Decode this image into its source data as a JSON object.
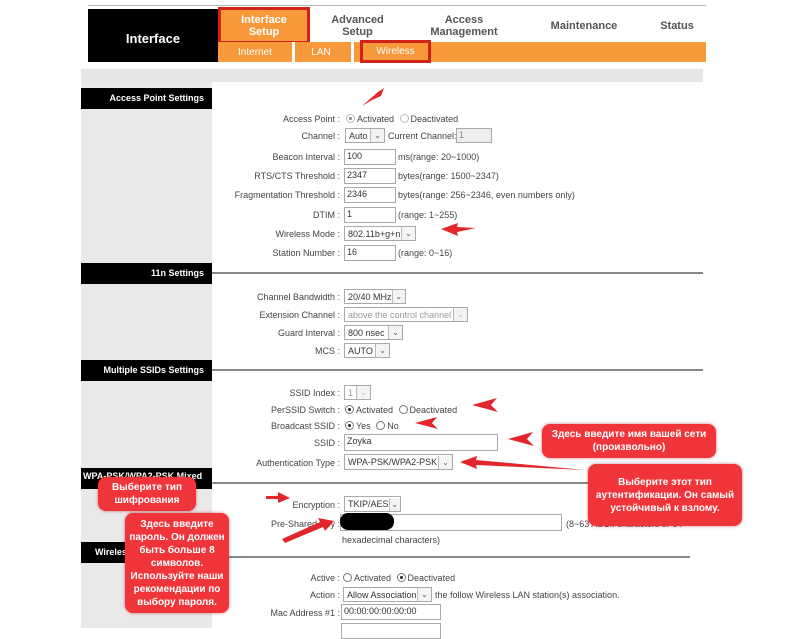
{
  "header": {
    "logo_text": "Interface",
    "nav": [
      {
        "label_line1": "Interface",
        "label_line2": "Setup",
        "active": true
      },
      {
        "label_line1": "Advanced",
        "label_line2": "Setup",
        "active": false
      },
      {
        "label_line1": "Access",
        "label_line2": "Management",
        "active": false
      },
      {
        "label_line1": "Maintenance",
        "label_line2": "",
        "active": false
      },
      {
        "label_line1": "Status",
        "label_line2": "",
        "active": false
      }
    ],
    "subnav": [
      {
        "label": "Internet"
      },
      {
        "label": "LAN"
      },
      {
        "label": "Wireless",
        "active": true
      }
    ]
  },
  "sections": {
    "access_point": {
      "title": "Access Point Settings",
      "access_point": {
        "label": "Access Point :",
        "options": [
          "Activated",
          "Deactivated"
        ],
        "selected": "Activated"
      },
      "channel": {
        "label": "Channel :",
        "value": "Auto",
        "current_label": "Current Channel:",
        "current_value": "1"
      },
      "beacon": {
        "label": "Beacon Interval :",
        "value": "100",
        "hint": "ms(range: 20~1000)"
      },
      "rts": {
        "label": "RTS/CTS Threshold :",
        "value": "2347",
        "hint": "bytes(range: 1500~2347)"
      },
      "frag": {
        "label": "Fragmentation Threshold :",
        "value": "2346",
        "hint": "bytes(range: 256~2346, even numbers only)"
      },
      "dtim": {
        "label": "DTIM :",
        "value": "1",
        "hint": "(range: 1~255)"
      },
      "mode": {
        "label": "Wireless Mode :",
        "value": "802.11b+g+n"
      },
      "station": {
        "label": "Station Number :",
        "value": "16",
        "hint": "(range: 0~16)"
      }
    },
    "n11": {
      "title": "11n Settings",
      "bandwidth": {
        "label": "Channel Bandwidth :",
        "value": "20/40 MHz"
      },
      "extension": {
        "label": "Extension Channel :",
        "value": "above the control channel"
      },
      "guard": {
        "label": "Guard Interval :",
        "value": "800 nsec"
      },
      "mcs": {
        "label": "MCS :",
        "value": "AUTO"
      }
    },
    "ssid": {
      "title": "Multiple SSIDs Settings",
      "index": {
        "label": "SSID Index :",
        "value": "1"
      },
      "perssid": {
        "label": "PerSSID Switch :",
        "options": [
          "Activated",
          "Deactivated"
        ],
        "selected": "Activated"
      },
      "broadcast": {
        "label": "Broadcast SSID :",
        "options": [
          "Yes",
          "No"
        ],
        "selected": "Yes"
      },
      "ssid": {
        "label": "SSID :",
        "value": "Zoyka"
      },
      "auth": {
        "label": "Authentication Type :",
        "value": "WPA-PSK/WPA2-PSK"
      }
    },
    "wpa": {
      "title": "WPA-PSK/WPA2-PSK Mixed",
      "encryption": {
        "label": "Encryption :",
        "value": "TKIP/AES"
      },
      "psk": {
        "label": "Pre-Shared Key :",
        "value": "",
        "hint": "(8~63 ASCII characters or 64",
        "hint2": "hexadecimal characters)"
      }
    },
    "mac": {
      "title": "Wireless MAC Address Filter",
      "active": {
        "label": "Active :",
        "options": [
          "Activated",
          "Deactivated"
        ],
        "selected": "Deactivated"
      },
      "action": {
        "label": "Action :",
        "value": "Allow Association",
        "hint": "the follow Wireless LAN station(s) association."
      },
      "mac1": {
        "label": "Mac Address #1 :",
        "value": "00:00:00:00:00:00"
      }
    }
  },
  "callouts": {
    "ssid_name": "Здесь введите имя вашей сети (произвольно)",
    "auth_type": "Выберите этот тип аутентификации. Он самый устойчивый к взлому.",
    "encryption": "Выберите тип шифрования",
    "password": "Здесь введите пароль. Он должен быть больше 8 символов. Используйте наши рекомендации по выбору пароля."
  },
  "colors": {
    "accent_orange": "#f7993a",
    "highlight_red": "#d2231a",
    "callout_red": "#f0353a"
  }
}
